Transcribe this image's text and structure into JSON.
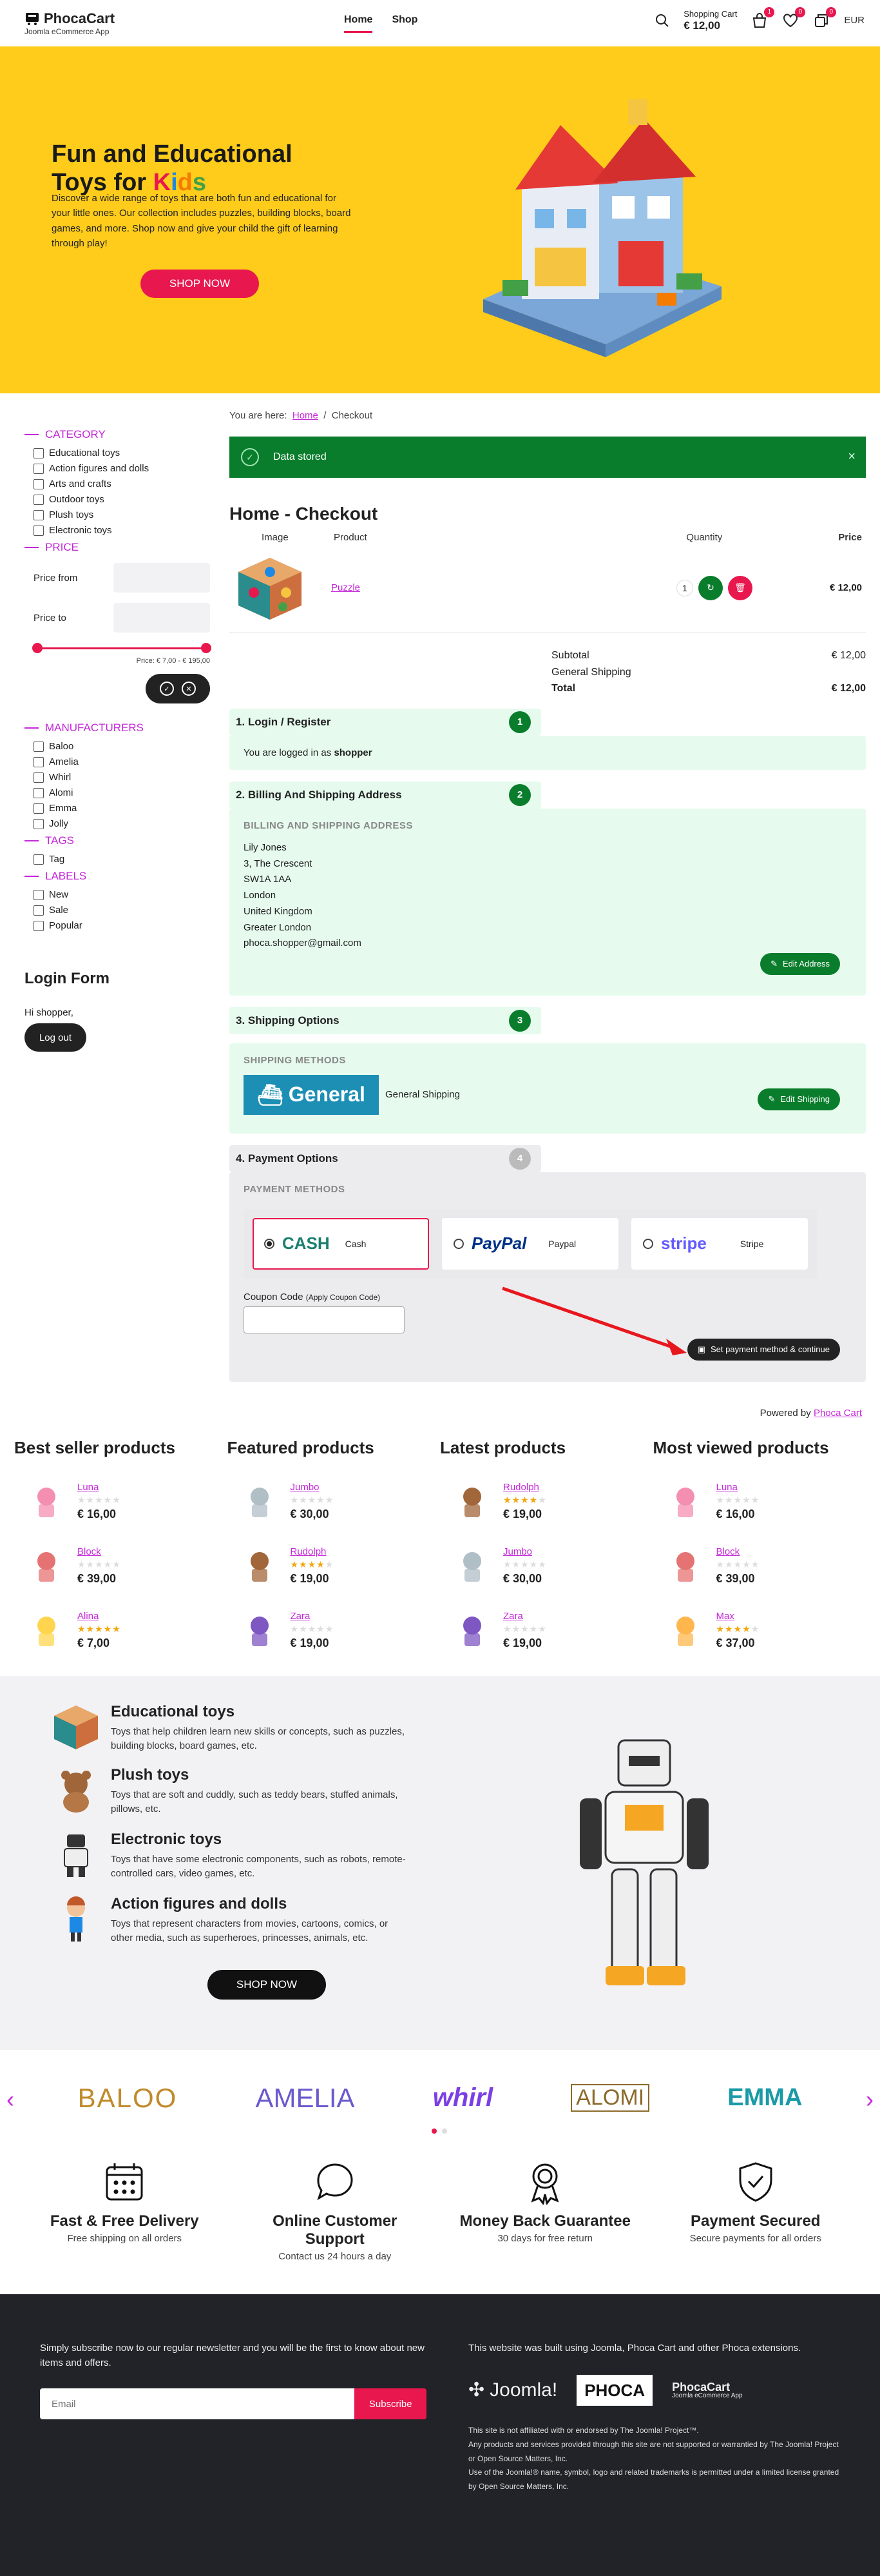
{
  "header": {
    "logo_title": "PhocaCart",
    "logo_sub": "Joomla eCommerce App",
    "nav": [
      "Home",
      "Shop"
    ],
    "cart_label": "Shopping Cart",
    "cart_total": "€ 12,00",
    "cart_count": "1",
    "wishlist_count": "0",
    "compare_count": "0",
    "currency": "EUR"
  },
  "hero": {
    "title_line1": "Fun and Educational",
    "title_line2": "Toys for",
    "kids": [
      "K",
      "i",
      "d",
      "s"
    ],
    "kids_colors": [
      "#e8174e",
      "#1e88e5",
      "#f57c00",
      "#43a047"
    ],
    "text": "Discover a wide range of toys that are both fun and educational for your little ones. Our collection includes puzzles, building blocks, board games, and more. Shop now and give your child the gift of learning through play!",
    "button": "SHOP NOW"
  },
  "sidebar": {
    "category_title": "CATEGORY",
    "categories": [
      "Educational toys",
      "Action figures and dolls",
      "Arts and crafts",
      "Outdoor toys",
      "Plush toys",
      "Electronic toys"
    ],
    "price_title": "PRICE",
    "price_from": "Price from",
    "price_to": "Price to",
    "price_range": "Price: € 7,00 - € 195,00",
    "manufacturers_title": "MANUFACTURERS",
    "manufacturers": [
      "Baloo",
      "Amelia",
      "Whirl",
      "Alomi",
      "Emma",
      "Jolly"
    ],
    "tags_title": "TAGS",
    "tags": [
      "Tag"
    ],
    "labels_title": "LABELS",
    "labels": [
      "New",
      "Sale",
      "Popular"
    ],
    "login_title": "Login Form",
    "greeting": "Hi shopper,",
    "logout": "Log out"
  },
  "main": {
    "breadcrumb_prefix": "You are here:",
    "breadcrumb_home": "Home",
    "breadcrumb_sep": "/",
    "breadcrumb_current": "Checkout",
    "alert": "Data stored",
    "title": "Home - Checkout",
    "table_headers": [
      "Image",
      "Product",
      "Quantity",
      "Price"
    ],
    "product_name": "Puzzle",
    "product_qty": "1",
    "product_price": "€ 12,00",
    "totals": [
      {
        "label": "Subtotal",
        "value": "€ 12,00"
      },
      {
        "label": "General Shipping",
        "value": ""
      },
      {
        "label": "Total",
        "value": "€ 12,00"
      }
    ],
    "step1_title": "1. Login / Register",
    "step1_num": "1",
    "step1_text": "You are logged in as",
    "step1_user": "shopper",
    "step2_title": "2. Billing And Shipping Address",
    "step2_num": "2",
    "step2_label": "BILLING AND SHIPPING ADDRESS",
    "address": [
      "Lily Jones",
      "3, The Crescent",
      "SW1A 1AA",
      "London",
      "United Kingdom",
      "Greater London",
      "phoca.shopper@gmail.com"
    ],
    "edit_address": "Edit Address",
    "step3_title": "3. Shipping Options",
    "step3_num": "3",
    "shipping_label": "SHIPPING METHODS",
    "shipping_logo": "General",
    "shipping_name": "General Shipping",
    "edit_shipping": "Edit Shipping",
    "step4_title": "4. Payment Options",
    "step4_num": "4",
    "payment_label": "PAYMENT METHODS",
    "payments": [
      {
        "logo": "CASH",
        "name": "Cash"
      },
      {
        "logo": "PayPal",
        "name": "Paypal"
      },
      {
        "logo": "stripe",
        "name": "Stripe"
      }
    ],
    "coupon_label": "Coupon Code",
    "coupon_hint": "(Apply Coupon Code)",
    "set_payment": "Set payment method & continue",
    "powered_by": "Powered by",
    "powered_link": "Phoca Cart"
  },
  "lists": [
    {
      "title": "Best seller products",
      "items": [
        {
          "name": "Luna",
          "price": "€ 16,00",
          "rating": 0
        },
        {
          "name": "Block",
          "price": "€ 39,00",
          "rating": 0
        },
        {
          "name": "Alina",
          "price": "€ 7,00",
          "rating": 5
        }
      ]
    },
    {
      "title": "Featured products",
      "items": [
        {
          "name": "Jumbo",
          "price": "€ 30,00",
          "rating": 0
        },
        {
          "name": "Rudolph",
          "price": "€ 19,00",
          "rating": 4
        },
        {
          "name": "Zara",
          "price": "€ 19,00",
          "rating": 0
        }
      ]
    },
    {
      "title": "Latest products",
      "items": [
        {
          "name": "Rudolph",
          "price": "€ 19,00",
          "rating": 4
        },
        {
          "name": "Jumbo",
          "price": "€ 30,00",
          "rating": 0
        },
        {
          "name": "Zara",
          "price": "€ 19,00",
          "rating": 0
        }
      ]
    },
    {
      "title": "Most viewed products",
      "items": [
        {
          "name": "Luna",
          "price": "€ 16,00",
          "rating": 0
        },
        {
          "name": "Block",
          "price": "€ 39,00",
          "rating": 0
        },
        {
          "name": "Max",
          "price": "€ 37,00",
          "rating": 4
        }
      ]
    }
  ],
  "categories_block": [
    {
      "title": "Educational toys",
      "text": "Toys that help children learn new skills or concepts, such as puzzles, building blocks, board games, etc."
    },
    {
      "title": "Plush toys",
      "text": "Toys that are soft and cuddly, such as teddy bears, stuffed animals, pillows, etc."
    },
    {
      "title": "Electronic toys",
      "text": "Toys that have some electronic components, such as robots, remote-controlled cars, video games, etc."
    },
    {
      "title": "Action figures and dolls",
      "text": "Toys that represent characters from movies, cartoons, comics, or other media, such as superheroes, princesses, animals, etc."
    }
  ],
  "categories_button": "SHOP NOW",
  "brands": [
    "BALOO",
    "AMELIA",
    "whirl",
    "ALOMI",
    "EMMA"
  ],
  "features": [
    {
      "title": "Fast & Free Delivery",
      "text": "Free shipping on all orders",
      "icon": "calendar-icon"
    },
    {
      "title": "Online Customer Support",
      "text": "Contact us 24 hours a day",
      "icon": "chat-icon"
    },
    {
      "title": "Money Back Guarantee",
      "text": "30 days for free return",
      "icon": "award-icon"
    },
    {
      "title": "Payment Secured",
      "text": "Secure payments for all orders",
      "icon": "shield-icon"
    }
  ],
  "footer": {
    "newsletter_text": "Simply subscribe now to our regular newsletter and you will be the first to know about new items and offers.",
    "email_placeholder": "Email",
    "subscribe": "Subscribe",
    "built_text": "This website was built using Joomla, Phoca Cart and other Phoca extensions.",
    "joomla_logo": "Joomla!",
    "phoca_logo": "PHOCA",
    "phocacart_logo": "PhocaCart",
    "phocacart_sub": "Joomla eCommerce App",
    "legal": [
      "This site is not affiliated with or endorsed by The Joomla! Project™.",
      "Any products and services provided through this site are not supported or warrantied by The Joomla! Project or Open Source Matters, Inc.",
      "Use of the Joomla!® name, symbol, logo and related trademarks is permitted under a limited license granted by Open Source Matters, Inc."
    ]
  },
  "colors": {
    "accent": "#e8174e",
    "purple": "#c526d9",
    "green": "#0a7d2c",
    "hero": "#ffcc1b",
    "dark": "#212328"
  }
}
